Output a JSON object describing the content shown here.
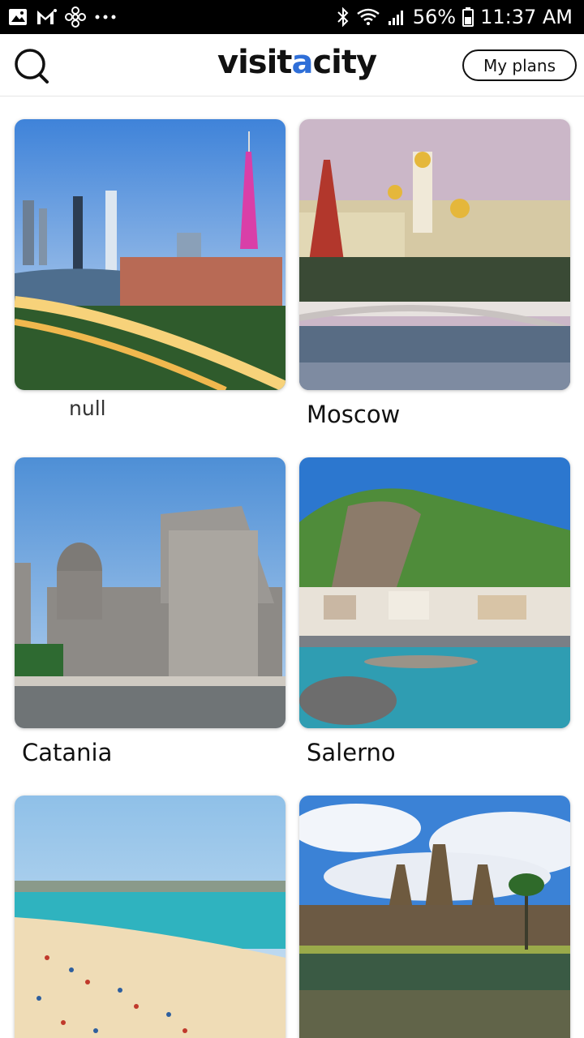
{
  "status_bar": {
    "battery": "56%",
    "time": "11:37 AM",
    "notification_icons": [
      "image-icon",
      "gmail-icon",
      "fan-icon",
      "more-icon"
    ],
    "system_icons": [
      "bluetooth-icon",
      "wifi-icon",
      "signal-icon",
      "battery-icon"
    ]
  },
  "header": {
    "logo_prefix": "visit",
    "logo_accent": "a",
    "logo_suffix": "city",
    "my_plans_label": "My plans"
  },
  "colors": {
    "logo_accent": "#2f6fd8",
    "text": "#111111"
  },
  "cities": [
    {
      "name": "null"
    },
    {
      "name": "Moscow"
    },
    {
      "name": "Catania"
    },
    {
      "name": "Salerno"
    },
    {
      "name": ""
    },
    {
      "name": ""
    }
  ]
}
